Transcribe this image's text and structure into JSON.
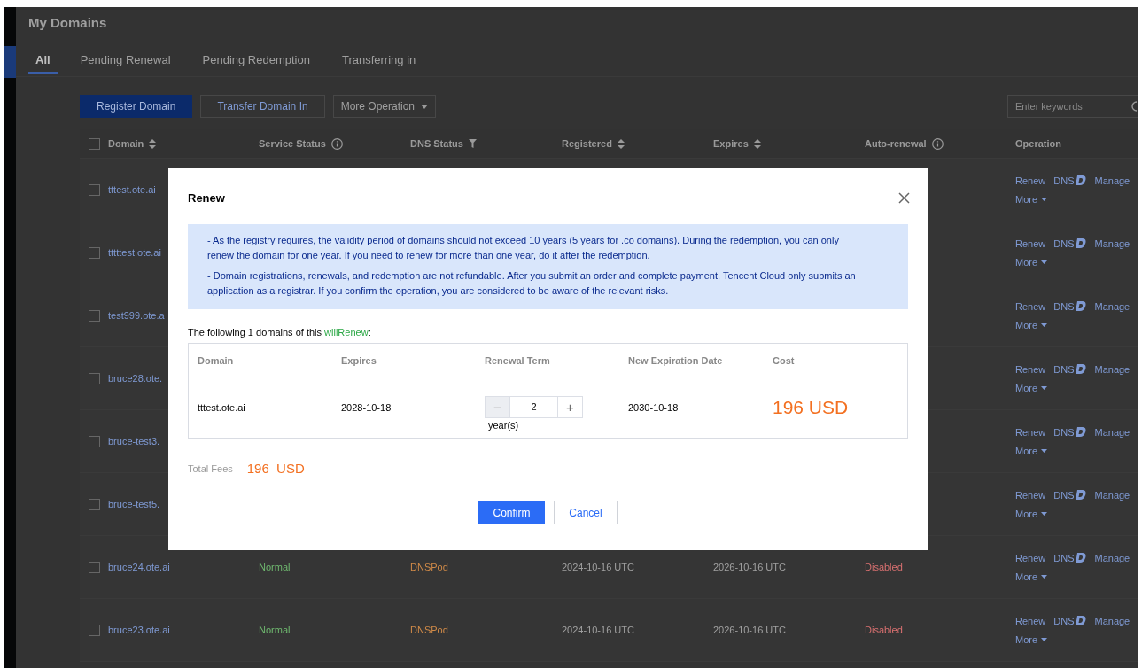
{
  "page_title": "My Domains",
  "tabs": [
    {
      "label": "All",
      "selected": true
    },
    {
      "label": "Pending Renewal",
      "selected": false
    },
    {
      "label": "Pending Redemption",
      "selected": false
    },
    {
      "label": "Transferring in",
      "selected": false
    }
  ],
  "toolbar": {
    "primary_button": "Register Domain",
    "secondary_button": "Transfer Domain In",
    "dropdown": "More Operation",
    "search_placeholder": "Enter keywords"
  },
  "table": {
    "columns": [
      {
        "label": "Domain",
        "kind": "sort"
      },
      {
        "label": "Service Status",
        "kind": "info"
      },
      {
        "label": "DNS Status",
        "kind": "filter"
      },
      {
        "label": "Registered",
        "kind": "sort"
      },
      {
        "label": "Expires",
        "kind": "sort"
      },
      {
        "label": "Auto-renewal",
        "kind": "info"
      },
      {
        "label": "Operation",
        "kind": "plain"
      }
    ],
    "select_all_checked": false,
    "rows": [
      {
        "checked": false,
        "domain": "tttest.ote.ai",
        "op_renew": "Renew",
        "op_dns": "DNS",
        "op_manage": "Manage",
        "op_more": "More"
      },
      {
        "checked": false,
        "domain": "tttttest.ote.ai",
        "op_renew": "Renew",
        "op_dns": "DNS",
        "op_manage": "Manage",
        "op_more": "More"
      },
      {
        "checked": false,
        "domain": "test999.ote.a",
        "op_renew": "Renew",
        "op_dns": "DNS",
        "op_manage": "Manage",
        "op_more": "More"
      },
      {
        "checked": false,
        "domain": "bruce28.ote.",
        "op_renew": "Renew",
        "op_dns": "DNS",
        "op_manage": "Manage",
        "op_more": "More"
      },
      {
        "checked": false,
        "domain": "bruce-test3.",
        "op_renew": "Renew",
        "op_dns": "DNS",
        "op_manage": "Manage",
        "op_more": "More"
      },
      {
        "checked": false,
        "domain": "bruce-test5.",
        "op_renew": "Renew",
        "op_dns": "DNS",
        "op_manage": "Manage",
        "op_more": "More"
      },
      {
        "checked": false,
        "domain": "bruce24.ote.ai",
        "status": "Normal",
        "dns": "DNSPod",
        "registered": "2024-10-16 UTC",
        "expires": "2026-10-16 UTC",
        "auto_renewal": "Disabled",
        "op_renew": "Renew",
        "op_dns": "DNS",
        "op_manage": "Manage",
        "op_more": "More"
      },
      {
        "checked": false,
        "domain": "bruce23.ote.ai",
        "status": "Normal",
        "dns": "DNSPod",
        "registered": "2024-10-16 UTC",
        "expires": "2026-10-16 UTC",
        "auto_renewal": "Disabled",
        "op_renew": "Renew",
        "op_dns": "DNS",
        "op_manage": "Manage",
        "op_more": "More"
      }
    ]
  },
  "dialog": {
    "title": "Renew",
    "notices": [
      "- As the registry requires, the validity period of domains should not exceed 10 years (5 years for .co domains). During the redemption, you can only renew the domain for one year. If you need to renew for more than one year, do it after the redemption.",
      "- Domain registrations, renewals, and redemption are not refundable. After you submit an order and complete payment, Tencent Cloud only submits an application as a registrar. If you confirm the operation, you are considered to be aware of the relevant risks."
    ],
    "intro_prefix": "The following 1 domains of this ",
    "intro_highlight": "willRenew",
    "intro_suffix": ":",
    "columns": [
      "Domain",
      "Expires",
      "Renewal Term",
      "New Expiration Date",
      "Cost"
    ],
    "rows": [
      {
        "domain": "tttest.ote.ai",
        "expires": "2028-10-18",
        "term": "2",
        "decrease_disabled": true,
        "minus": "−",
        "plus": "+",
        "unit": "year(s)",
        "new_expiration": "2030-10-18",
        "cost": "196 USD"
      }
    ],
    "total_label": "Total Fees",
    "total_value": "196  USD",
    "confirm": "Confirm",
    "cancel": "Cancel"
  }
}
